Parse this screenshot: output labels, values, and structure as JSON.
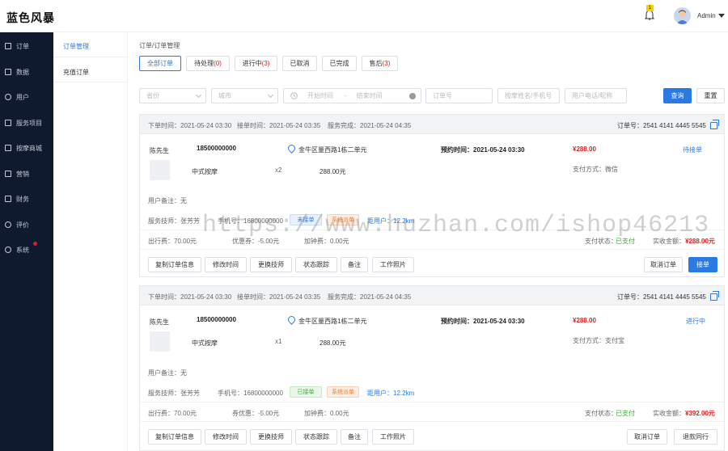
{
  "header": {
    "brand": "蓝色风暴",
    "notification_count": "1",
    "user": "Admin"
  },
  "sidebar": {
    "items": [
      {
        "label": "订单",
        "icon": "order-icon"
      },
      {
        "label": "数据",
        "icon": "data-icon"
      },
      {
        "label": "用户",
        "icon": "user-icon"
      },
      {
        "label": "服务项目",
        "icon": "service-icon"
      },
      {
        "label": "按摩商城",
        "icon": "mall-icon"
      },
      {
        "label": "营销",
        "icon": "marketing-icon"
      },
      {
        "label": "财务",
        "icon": "finance-icon"
      },
      {
        "label": "评价",
        "icon": "review-icon"
      },
      {
        "label": "系统",
        "icon": "system-icon"
      }
    ]
  },
  "submenu": {
    "items": [
      "订单管理",
      "充值订单"
    ]
  },
  "breadcrumb": "订单/订单管理",
  "tabs": [
    {
      "label": "全部订单",
      "count": ""
    },
    {
      "label": "待处理",
      "count": "(0)"
    },
    {
      "label": "进行中",
      "count": "(3)"
    },
    {
      "label": "已取消",
      "count": ""
    },
    {
      "label": "已完成",
      "count": ""
    },
    {
      "label": "售后",
      "count": "(3)"
    }
  ],
  "filters": {
    "province": "省份",
    "city": "城市",
    "start_time": "开始时间",
    "separator": "-",
    "end_time": "结束时间",
    "order_no": "订单号",
    "tech": "按摩姓名/手机号",
    "user": "用户电话/昵称",
    "query": "查询",
    "reset": "重置"
  },
  "orders": [
    {
      "order_time": "下单时间：2021-05-24  03:30",
      "accept_time": "接单时间：2021-05-24  03:35",
      "finish_time": "服务完成：2021-05-24  04:35",
      "order_no": "订单号：2541 4141 4445 5545",
      "customer": "陈先生",
      "phone": "18500000000",
      "address": "金牛区量西路1栋二单元",
      "appointment": "预约时间：2021-05-24  03:30",
      "total": "¥288.00",
      "status": "待接单",
      "service_name": "中式按摩",
      "qty": "x2",
      "price": "288.00元",
      "pay_method": "支付方式：微信",
      "remark": "用户备注：无",
      "tech": "服务技师：张芳芳",
      "tech_phone": "手机号：16800000000",
      "tag1": "未接单",
      "tag2": "系统派单",
      "distance": "距用户：12.2km",
      "travel_fee": "出行费：70.00元",
      "discount": "优惠券：-5.00元",
      "bell_fee": "加钟费：0.00元",
      "pay_status_label": "支付状态：",
      "pay_status": "已支付",
      "actual_label": "实收金额：",
      "actual": "¥288.00元",
      "actions": [
        "复制订单信息",
        "修改时间",
        "更换技师",
        "状态跟踪",
        "备注",
        "工作照片"
      ],
      "right_actions": [
        "取消订单",
        "接单"
      ]
    },
    {
      "order_time": "下单时间：2021-05-24  03:30",
      "accept_time": "接单时间：2021-05-24  03:35",
      "finish_time": "服务完成：2021-05-24  04:35",
      "order_no": "订单号：2541 4141 4445 5545",
      "customer": "陈先生",
      "phone": "18500000000",
      "address": "金牛区量西路1栋二单元",
      "appointment": "预约时间：2021-05-24  03:30",
      "total": "¥288.00",
      "status": "进行中",
      "service_name": "中式按摩",
      "qty": "x1",
      "price": "288.00元",
      "pay_method": "支付方式：支付宝",
      "remark": "用户备注：无",
      "tech": "服务技师：张芳芳",
      "tech_phone": "手机号：16800000000",
      "tag1": "已接单",
      "tag2": "系统派单",
      "distance": "距用户：12.2km",
      "travel_fee": "出行费：70.00元",
      "discount": "券优惠：-5.00元",
      "bell_fee": "加钟费：0.00元",
      "pay_status_label": "支付状态：",
      "pay_status": "已支付",
      "actual_label": "实收金额：",
      "actual": "¥392.00元",
      "actions": [
        "复制订单信息",
        "修改时间",
        "更换技师",
        "状态跟踪",
        "备注",
        "工作照片"
      ],
      "right_actions": [
        "取消订单",
        "退款同行"
      ]
    }
  ],
  "watermark": "https://www.huzhan.com/ishop46213"
}
